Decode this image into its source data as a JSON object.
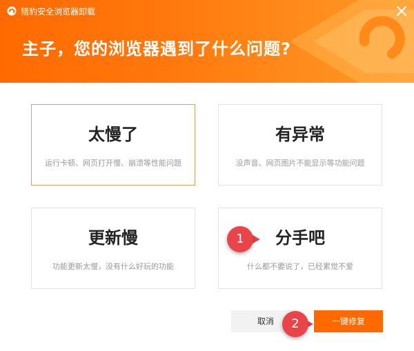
{
  "window": {
    "title": "猎豹安全浏览器卸载",
    "close_icon": "close-icon"
  },
  "header": {
    "headline": "主子，您的浏览器遇到了什么问题?",
    "background_color": "#ff7a0f"
  },
  "options": [
    {
      "title": "太慢了",
      "description": "运行卡顿、网页打开慢、崩溃等性能问题",
      "selected": true
    },
    {
      "title": "有异常",
      "description": "没声音、网页图片不能显示等功能问题",
      "selected": false
    },
    {
      "title": "更新慢",
      "description": "功能更新太慢，没有什么好玩的功能",
      "selected": false
    },
    {
      "title": "分手吧",
      "description": "什么都不要说了，已经累觉不爱",
      "selected": false
    }
  ],
  "buttons": {
    "cancel": "取消",
    "repair": "一键修复"
  },
  "annotations": {
    "marker1": "1",
    "marker2": "2",
    "color": "#e8444a"
  }
}
